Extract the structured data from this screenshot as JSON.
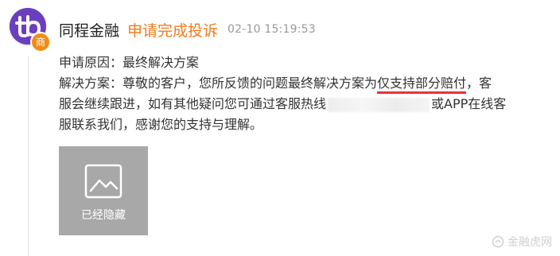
{
  "merchant": {
    "name": "同程金融",
    "badge_label": "商",
    "avatar_icon": "tongcheng-logo-icon",
    "avatar_color": "#6a3fbf",
    "badge_color": "#f28c18"
  },
  "status": {
    "text": "申请完成投诉",
    "color": "#f07a1c"
  },
  "timestamp": "02-10 15:19:53",
  "body": {
    "reason_line": "申请原因：最终解决方案",
    "solution_prefix": "解决方案：尊敬的客户，您所反馈的问题最终解决方案为",
    "solution_highlight": "仅支持部分赔付",
    "solution_suffix": "，客",
    "line2_start": "服会继续跟进，如有其他疑问您可通过客服热线",
    "line2_end": "或APP在线客",
    "line3": "服联系我们，感谢您的支持与理解。",
    "highlight_color": "#e8323c"
  },
  "attachment": {
    "label": "已经隐藏",
    "icon": "image-placeholder-icon"
  },
  "watermark": {
    "text": "金融虎网",
    "icon": "watermark-logo-icon"
  }
}
